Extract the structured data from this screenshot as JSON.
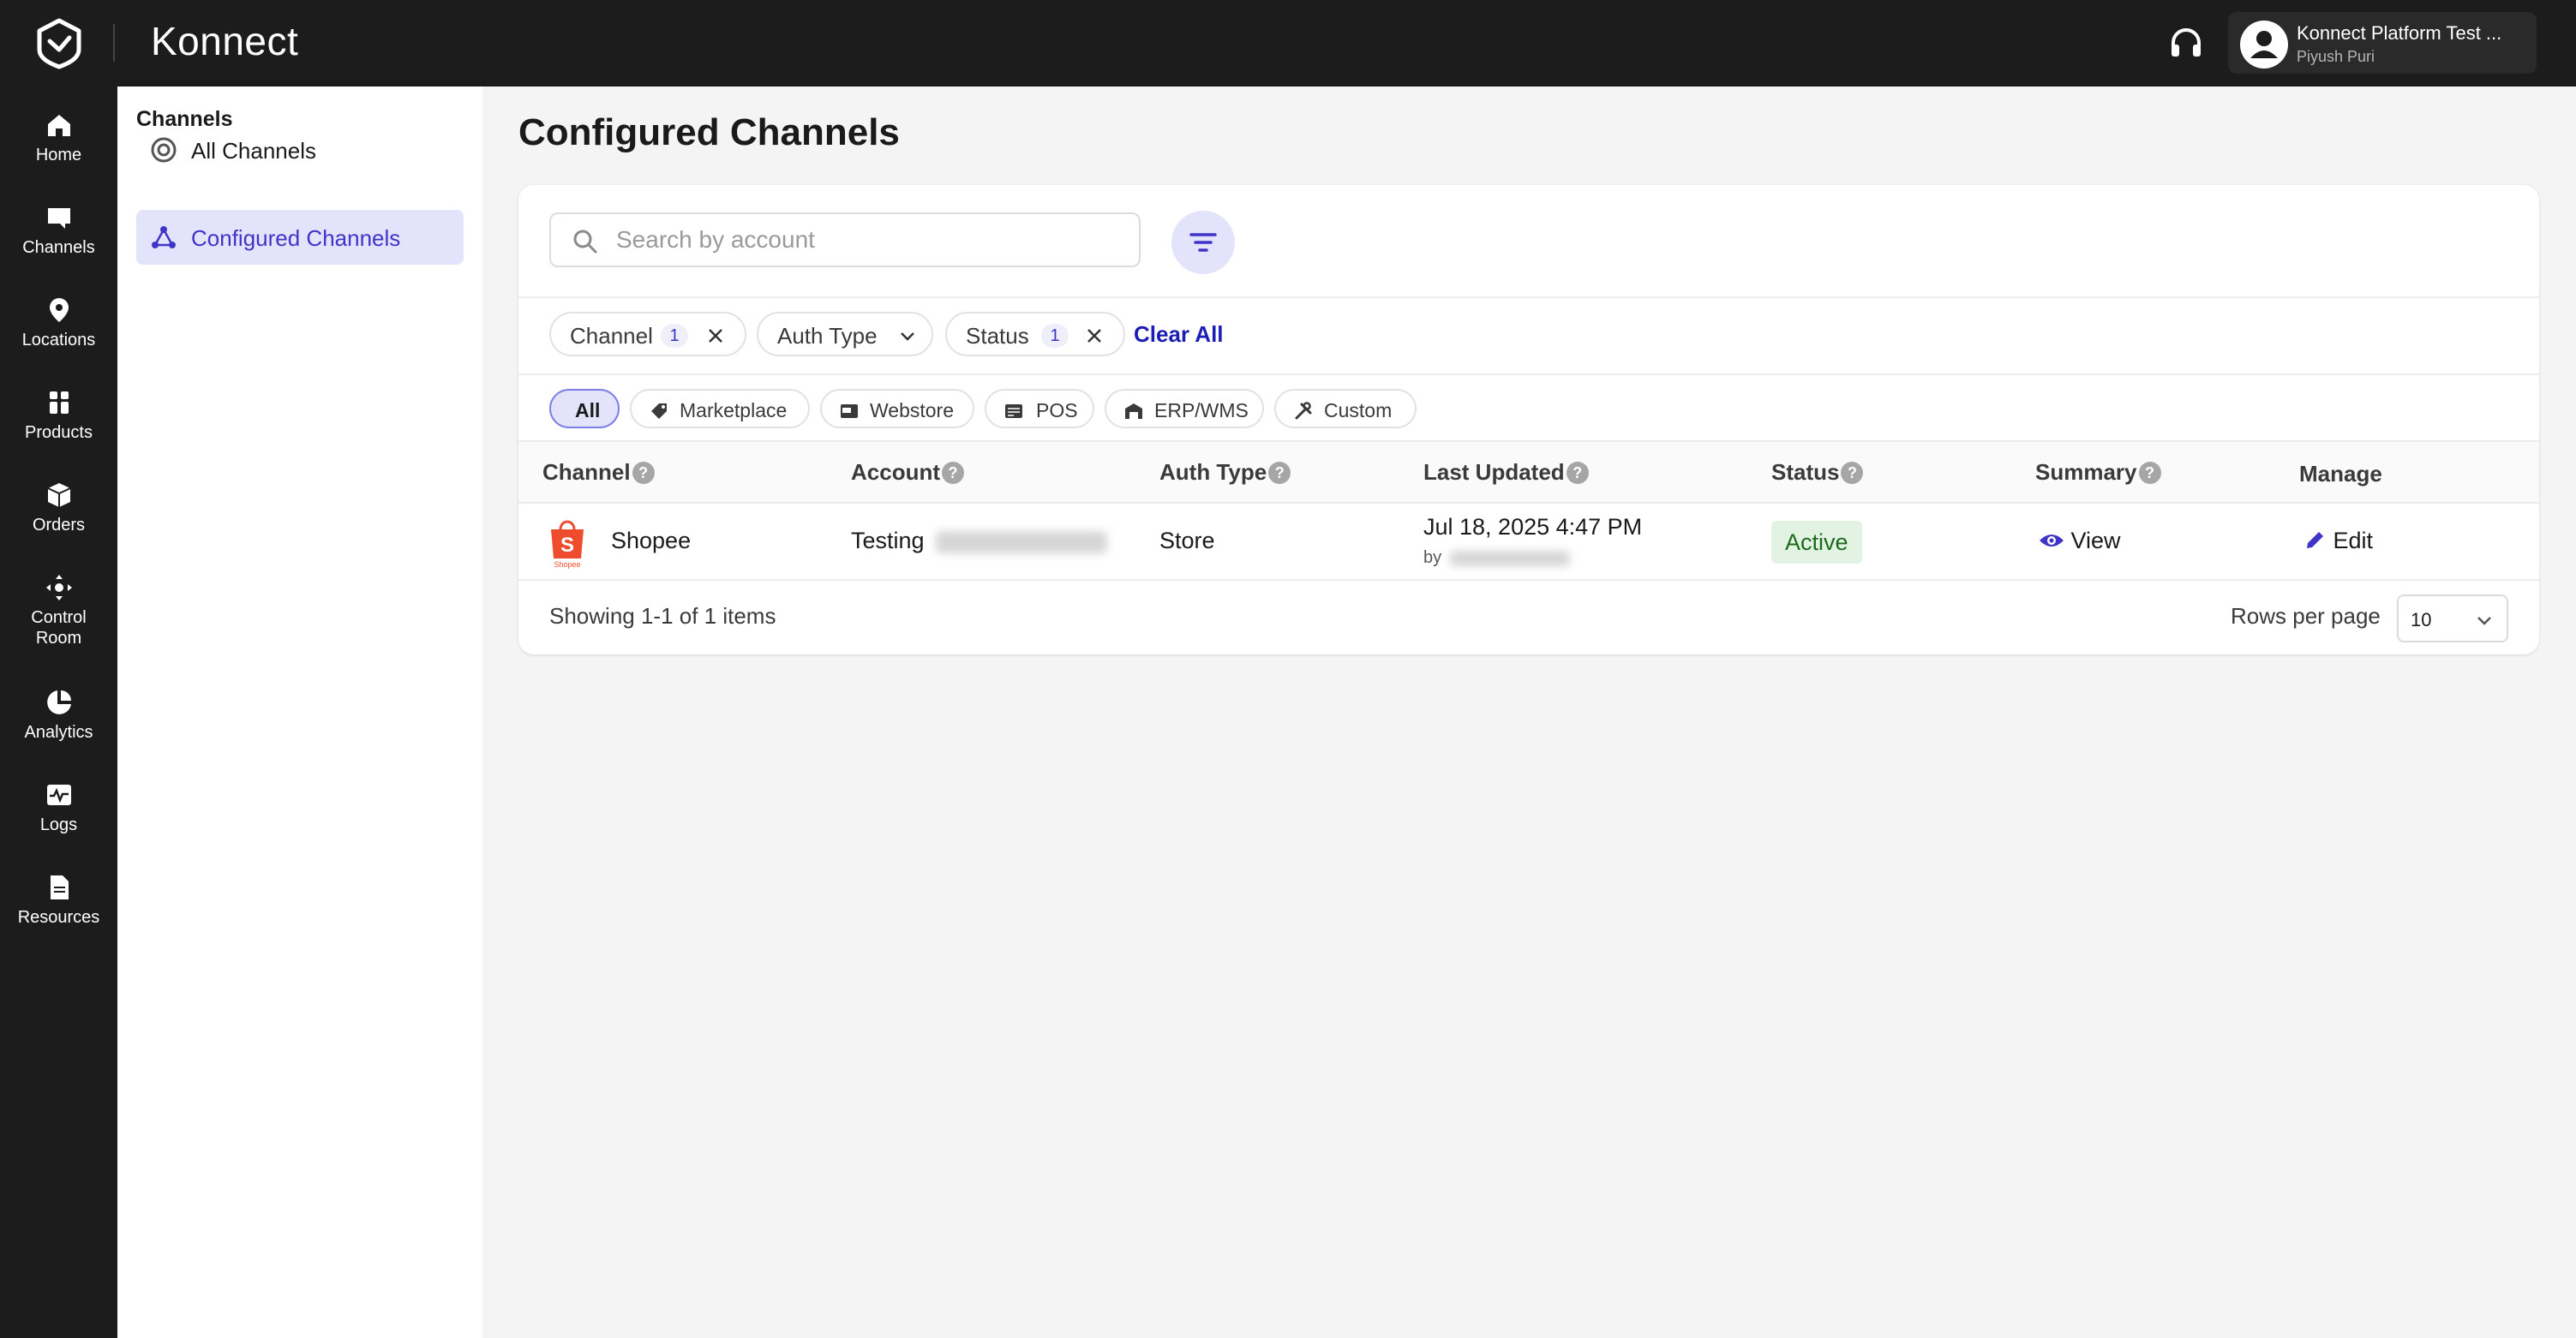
{
  "app": {
    "brand": "Konnect"
  },
  "account": {
    "name": "Konnect Platform Test ...",
    "user": "Piyush Puri"
  },
  "rail": [
    {
      "label": "Home",
      "icon": "home-icon"
    },
    {
      "label": "Channels",
      "icon": "channels-icon"
    },
    {
      "label": "Locations",
      "icon": "location-pin-icon"
    },
    {
      "label": "Products",
      "icon": "products-icon"
    },
    {
      "label": "Orders",
      "icon": "orders-box-icon"
    },
    {
      "label": "Control Room",
      "icon": "control-room-icon"
    },
    {
      "label": "Analytics",
      "icon": "analytics-pie-icon"
    },
    {
      "label": "Logs",
      "icon": "logs-icon"
    },
    {
      "label": "Resources",
      "icon": "resources-doc-icon"
    }
  ],
  "subnav": {
    "title": "Channels",
    "items": [
      {
        "label": "All Channels",
        "icon": "all-channels-icon",
        "active": false
      },
      {
        "label": "Configured Channels",
        "icon": "configured-channels-icon",
        "active": true
      }
    ]
  },
  "page": {
    "title": "Configured Channels"
  },
  "search": {
    "placeholder": "Search by account"
  },
  "filters": {
    "chips": [
      {
        "label": "Channel",
        "count": "1",
        "removable": true
      },
      {
        "label": "Auth Type",
        "dropdown": true
      },
      {
        "label": "Status",
        "count": "1",
        "removable": true
      }
    ],
    "clear_all": "Clear All"
  },
  "categories": [
    {
      "label": "All",
      "active": true
    },
    {
      "label": "Marketplace",
      "icon": "tag-icon"
    },
    {
      "label": "Webstore",
      "icon": "webstore-icon"
    },
    {
      "label": "POS",
      "icon": "pos-icon"
    },
    {
      "label": "ERP/WMS",
      "icon": "warehouse-icon"
    },
    {
      "label": "Custom",
      "icon": "tools-icon"
    }
  ],
  "table": {
    "columns": [
      "Channel",
      "Account",
      "Auth Type",
      "Last Updated",
      "Status",
      "Summary",
      "Manage"
    ],
    "rows": [
      {
        "channel": "Shopee",
        "channel_logo_text": "Shopee",
        "account": "Testing",
        "auth_type": "Store",
        "last_updated": "Jul 18, 2025 4:47 PM",
        "updated_by_prefix": "by",
        "status": "Active",
        "summary_action": "View",
        "manage_action": "Edit"
      }
    ]
  },
  "pagination": {
    "showing": "Showing 1-1 of 1 items",
    "rows_per_page_label": "Rows per page",
    "rows_per_page": "10"
  },
  "colors": {
    "accent": "#3e35c8",
    "topbar": "#1c1c1c",
    "active_bg": "#e3e4fb",
    "status_active_bg": "#e3f3e3",
    "shopee": "#ee4d2d"
  }
}
